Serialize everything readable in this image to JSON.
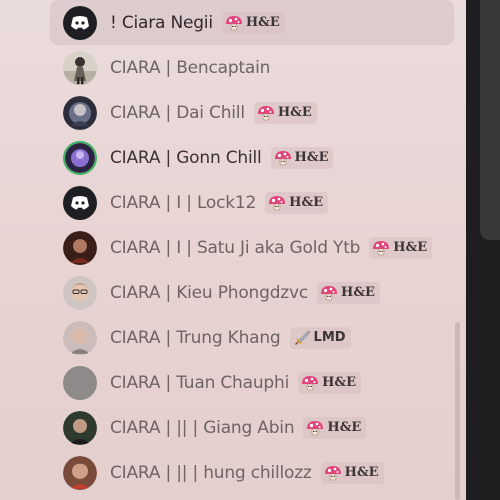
{
  "members": [
    {
      "name": "! Ciara Negii",
      "avatar": "discord-logo",
      "selected": true,
      "badge": {
        "icon": "mushroom-icon",
        "text": "H&E"
      }
    },
    {
      "name": "CIARA | Bencaptain",
      "avatar": "photo-avatar",
      "badge": null
    },
    {
      "name": "CIARA | Dai Chill",
      "avatar": "photo-avatar",
      "badge": {
        "icon": "mushroom-icon",
        "text": "H&E"
      }
    },
    {
      "name": "CIARA | Gonn Chill",
      "avatar": "photo-avatar",
      "badge": {
        "icon": "mushroom-icon",
        "text": "H&E"
      }
    },
    {
      "name": "CIARA | I | Lock12",
      "avatar": "discord-logo",
      "badge": {
        "icon": "mushroom-icon",
        "text": "H&E"
      }
    },
    {
      "name": "CIARA | I | Satu Ji aka Gold Ytb",
      "avatar": "photo-avatar",
      "badge": {
        "icon": "mushroom-icon",
        "text": "H&E"
      }
    },
    {
      "name": "CIARA | Kieu Phongdzvc",
      "avatar": "photo-avatar",
      "badge": {
        "icon": "mushroom-icon",
        "text": "H&E"
      }
    },
    {
      "name": "CIARA | Trung Khang",
      "avatar": "photo-avatar",
      "badge": {
        "icon": "sword-icon",
        "text": "LMD"
      }
    },
    {
      "name": "CIARA | Tuan Chauphi",
      "avatar": "default-gray-avatar",
      "badge": {
        "icon": "mushroom-icon",
        "text": "H&E"
      }
    },
    {
      "name": "CIARA | || | Giang Abin",
      "avatar": "photo-avatar",
      "badge": {
        "icon": "mushroom-icon",
        "text": "H&E"
      }
    },
    {
      "name": "CIARA | || | hung chillozz",
      "avatar": "photo-avatar",
      "badge": {
        "icon": "mushroom-icon",
        "text": "H&E"
      }
    }
  ],
  "colors": {
    "background": "#e7d3d2",
    "name_text": "#6e6466",
    "badge_bg": "#dcc4c5",
    "mushroom_cap": "#e0457b",
    "discord_bg": "#1e1f22",
    "online_ring": "#3fb463"
  }
}
